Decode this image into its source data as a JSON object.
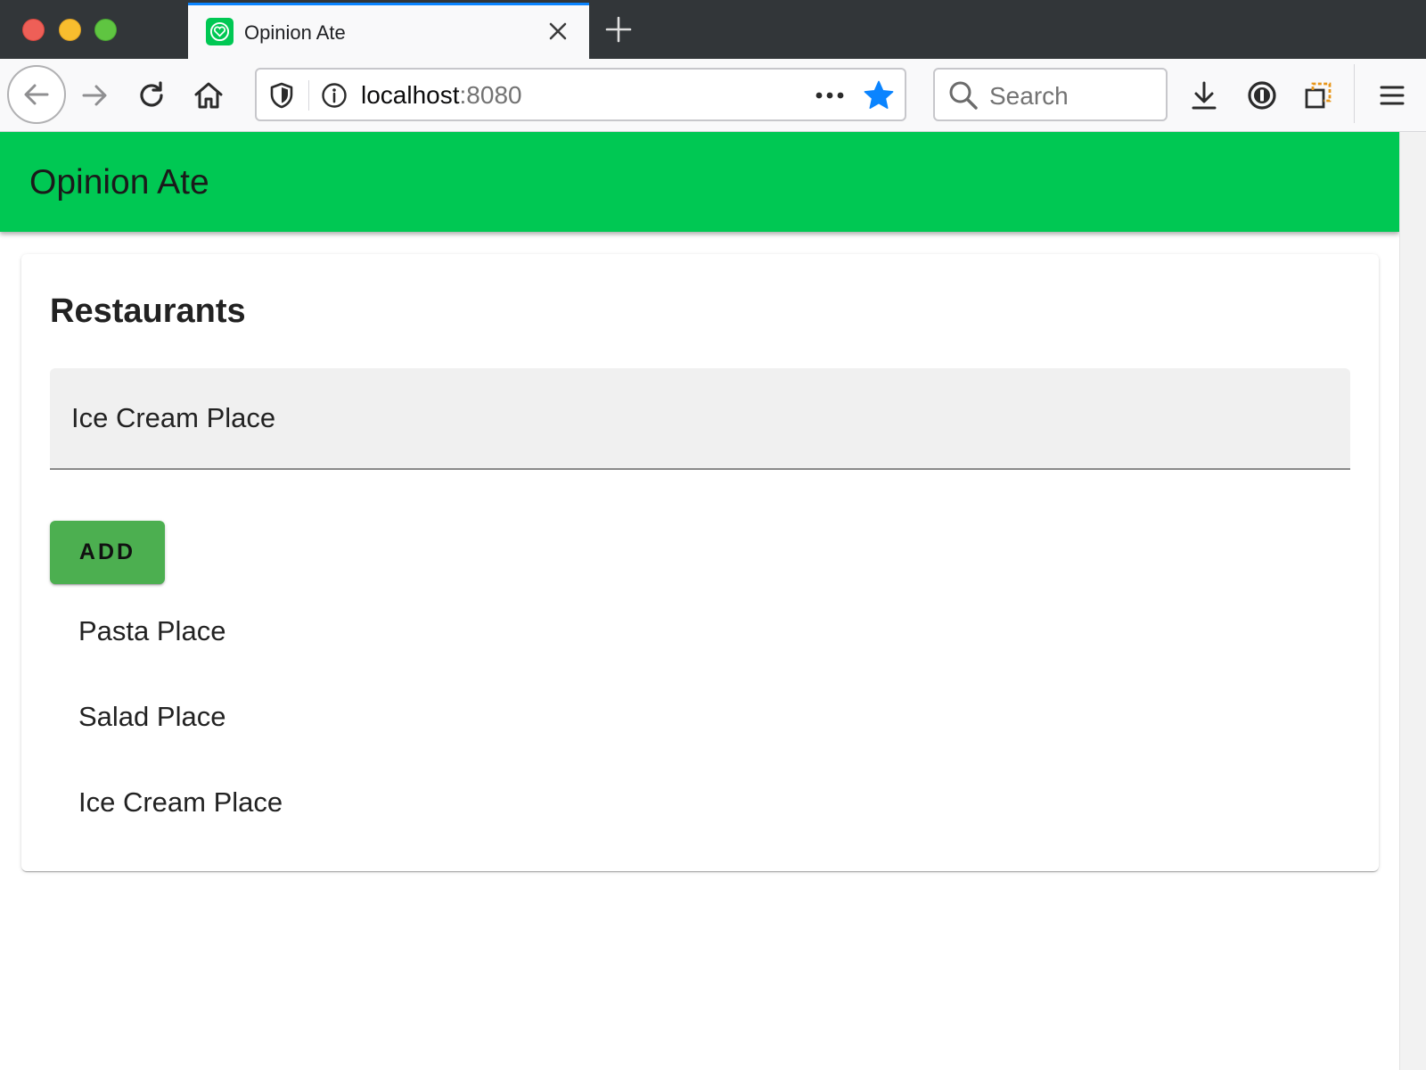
{
  "browser": {
    "tab": {
      "title": "Opinion Ate"
    },
    "url": {
      "host": "localhost",
      "port": ":8080"
    },
    "search": {
      "placeholder": "Search"
    },
    "icons": {
      "favicon": "heart-shield-icon",
      "back": "arrow-left-icon",
      "forward": "arrow-right-icon",
      "reload": "reload-icon",
      "home": "home-icon",
      "tracking": "shield-icon",
      "info": "info-icon",
      "more": "more-horizontal-icon",
      "bookmark": "star-icon",
      "download": "download-icon",
      "lastpass": "lastpass-icon",
      "containers": "containers-icon",
      "menu": "hamburger-menu-icon"
    },
    "colors": {
      "tab_accent": "#0a84ff",
      "bookmark_star": "#0a84ff"
    }
  },
  "app": {
    "title": "Opinion Ate",
    "colors": {
      "appbar": "#00c853",
      "add_button": "#4caf50"
    }
  },
  "restaurants": {
    "heading": "Restaurants",
    "new_name_value": "Ice Cream Place",
    "add_label": "ADD",
    "items": [
      {
        "name": "Pasta Place"
      },
      {
        "name": "Salad Place"
      },
      {
        "name": "Ice Cream Place"
      }
    ]
  }
}
